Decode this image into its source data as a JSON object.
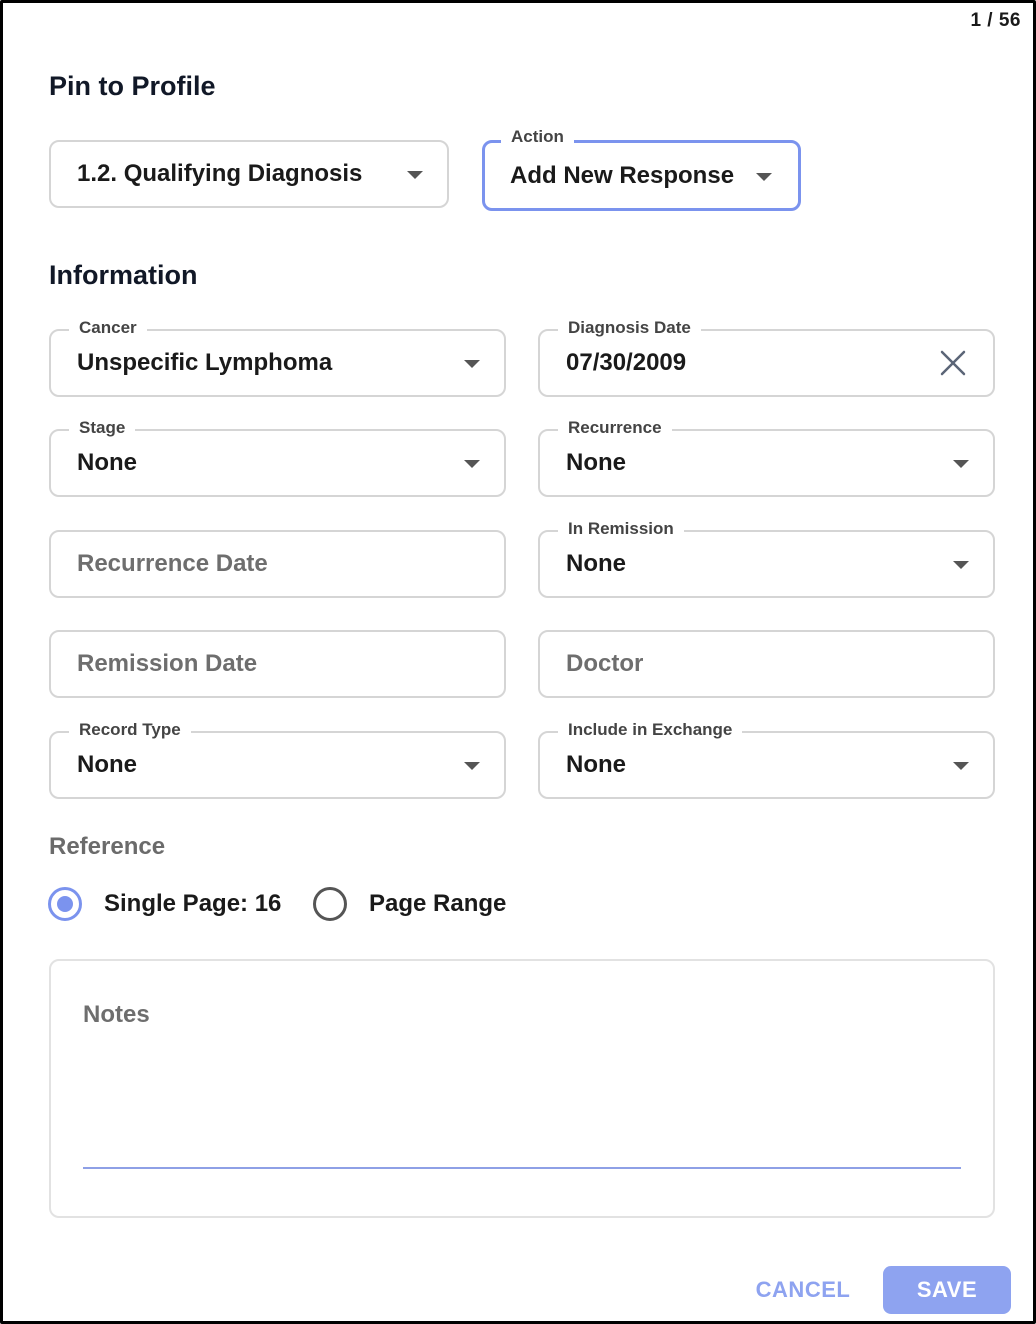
{
  "page_counter": "1 / 56",
  "pin_section": {
    "title": "Pin to Profile",
    "question_select": {
      "value": "1.2. Qualifying Diagnosis"
    },
    "action_select": {
      "label": "Action",
      "value": "Add New Response"
    }
  },
  "information": {
    "title": "Information",
    "cancer": {
      "label": "Cancer",
      "value": "Unspecific Lymphoma"
    },
    "diagnosis_date": {
      "label": "Diagnosis Date",
      "value": "07/30/2009"
    },
    "stage": {
      "label": "Stage",
      "value": "None"
    },
    "recurrence": {
      "label": "Recurrence",
      "value": "None"
    },
    "recurrence_date": {
      "placeholder": "Recurrence Date"
    },
    "in_remission": {
      "label": "In Remission",
      "value": "None"
    },
    "remission_date": {
      "placeholder": "Remission Date"
    },
    "doctor": {
      "placeholder": "Doctor"
    },
    "record_type": {
      "label": "Record Type",
      "value": "None"
    },
    "include_in_exchange": {
      "label": "Include in Exchange",
      "value": "None"
    }
  },
  "reference": {
    "title": "Reference",
    "options": [
      {
        "label": "Single Page: 16",
        "selected": true
      },
      {
        "label": "Page Range",
        "selected": false
      }
    ]
  },
  "notes": {
    "placeholder": "Notes"
  },
  "actions": {
    "cancel_label": "CANCEL",
    "save_label": "SAVE"
  },
  "colors": {
    "accent": "#7b93ee",
    "button": "#8ea3f0",
    "border": "#d5d5d5"
  }
}
